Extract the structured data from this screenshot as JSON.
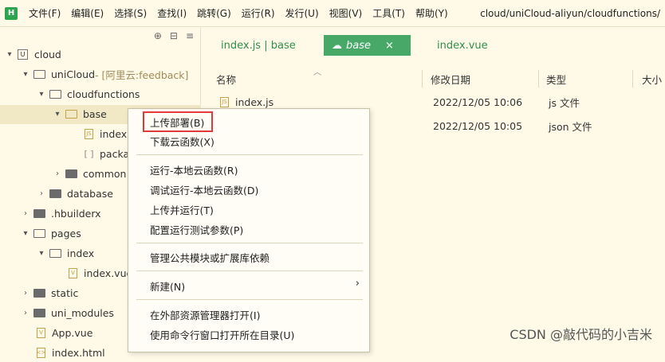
{
  "menubar": {
    "items": [
      "文件(F)",
      "编辑(E)",
      "选择(S)",
      "查找(I)",
      "跳转(G)",
      "运行(R)",
      "发行(U)",
      "视图(V)",
      "工具(T)",
      "帮助(Y)"
    ],
    "path": "cloud/uniCloud-aliyun/cloudfunctions/"
  },
  "sidebar": {
    "tools": [
      "⊕",
      "⊟",
      "≡"
    ],
    "tree": [
      {
        "label": "cloud",
        "remark": ""
      },
      {
        "label": "uniCloud",
        "remark": " - [阿里云:feedback]"
      },
      {
        "label": "cloudfunctions",
        "remark": ""
      },
      {
        "label": "base",
        "remark": ""
      },
      {
        "label": "index",
        "remark": ""
      },
      {
        "label": "packa",
        "remark": ""
      },
      {
        "label": "common",
        "remark": ""
      },
      {
        "label": "database",
        "remark": ""
      },
      {
        "label": ".hbuilderx",
        "remark": ""
      },
      {
        "label": "pages",
        "remark": ""
      },
      {
        "label": "index",
        "remark": ""
      },
      {
        "label": "index.vue",
        "remark": ""
      },
      {
        "label": "static",
        "remark": ""
      },
      {
        "label": "uni_modules",
        "remark": ""
      },
      {
        "label": "App.vue",
        "remark": ""
      },
      {
        "label": "index.html",
        "remark": ""
      }
    ]
  },
  "tabs": [
    {
      "label": "index.js | base"
    },
    {
      "label": "base"
    },
    {
      "label": "index.vue"
    }
  ],
  "file_table": {
    "columns": [
      "名称",
      "修改日期",
      "类型",
      "大小"
    ],
    "rows": [
      {
        "name": "index.js",
        "date": "2022/12/05 10:06",
        "type": "js 文件"
      },
      {
        "name": "",
        "date": "2022/12/05 10:05",
        "type": "json 文件"
      }
    ]
  },
  "context_menu": {
    "items": [
      "上传部署(B)",
      "下载云函数(X)",
      "运行-本地云函数(R)",
      "调试运行-本地云函数(D)",
      "上传并运行(T)",
      "配置运行测试参数(P)",
      "管理公共模块或扩展库依赖",
      "新建(N)",
      "在外部资源管理器打开(I)",
      "使用命令行窗口打开所在目录(U)"
    ]
  },
  "watermark": "CSDN @敲代码的小吉米"
}
